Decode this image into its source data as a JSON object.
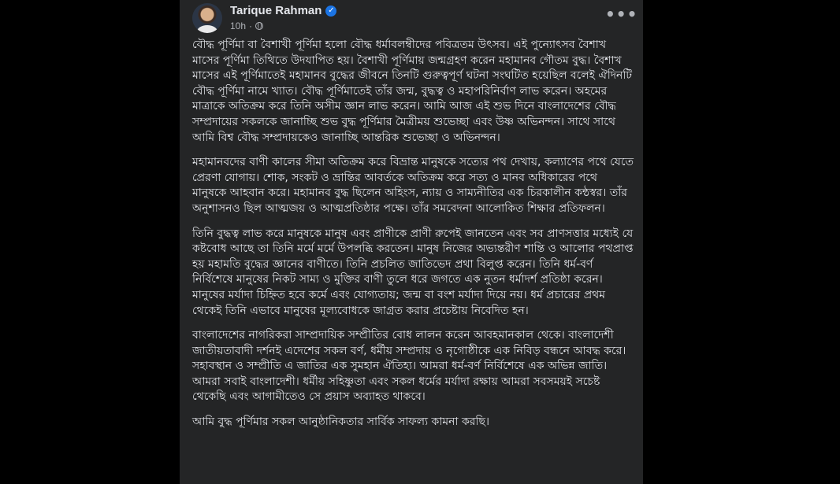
{
  "post": {
    "author": "Tarique Rahman",
    "time": "10h",
    "more_label": "•••",
    "verified_glyph": "✓",
    "paragraphs": [
      "বৌদ্ধ পূর্ণিমা বা বৈশাখী পূর্ণিমা হলো বৌদ্ধ ধর্মাবলম্বীদের পবিত্রতম উৎসব। এই পুন্যোৎসব বৈশাখ মাসের পূর্ণিমা তিথিতে উদযাপিত হয়। বৈশাখী পূর্ণিমায় জন্মগ্রহণ করেন মহামানব গৌতম বুদ্ধ। বৈশাখ মাসের এই পূর্ণিমাতেই মহামানব বুদ্ধের জীবনে তিনটি গুরুত্বপূর্ণ ঘটনা সংঘটিত হয়েছিল বলেই ঐদিনটি বৌদ্ধ পূর্ণিমা নামে খ্যাত। বৌদ্ধ পূর্ণিমাতেই তাঁর জন্ম, বুদ্ধত্ব ও মহাপরিনির্বাণ লাভ করেন। অহমের মাত্রাকে অতিক্রম করে তিনি অসীম জ্ঞান লাভ করেন। আমি আজ এই শুভ দিনে বাংলাদেশের বৌদ্ধ সম্প্রদায়ের সকলকে জানাচ্ছি শুভ বুদ্ধ পূর্ণিমার মৈত্রীময় শুভেচ্ছা এবং উষ্ণ অভিনন্দন। সাথে সাথে আমি বিশ্ব বৌদ্ধ সম্প্রদায়কেও জানাচ্ছি আন্তরিক শুভেচ্ছা ও অভিনন্দন।",
      "মহামানবদের বাণী কালের সীমা অতিক্রম করে বিভ্রান্ত মানুষকে সত্যের পথ দেখায়, কল্যাণের পথে যেতে প্রেরণা যোগায়। শোক, সংকট ও ভ্রান্তির আবর্তকে অতিক্রম করে সত্য ও মানব অধিকারের পথে মানুষকে আহবান করে। মহামানব বুদ্ধ ছিলেন অহিংস, ন্যায় ও সাম্যনীতির এক চিরকালীন কন্ঠস্বর। তাঁর অনুশাসনও ছিল আত্মজয় ও আত্মপ্রতিষ্ঠার পক্ষে। তাঁর সমবেদনা আলোকিত শিক্ষার প্রতিফলন।",
      "তিনি বুদ্ধত্ব লাভ করে মানুষকে মানুষ এবং প্রাণীকে প্রাণী রুপেই জানতেন এবং সব প্রাণসত্তার মধ্যেই যে কষ্টবোধ আছে তা তিনি মর্মে মর্মে উপলব্ধি করতেন। মানুষ নিজের অভ্যন্তরীণ শান্তি ও আলোর পথপ্রাপ্ত হয় মহামতি বুদ্ধের জ্ঞানের বাণীতে। তিনি প্রচলিত জাতিভেদ প্রথা বিলুপ্ত করেন। তিনি ধর্ম-বর্ণ নির্বিশেষে মানুষের নিকট সাম্য ও মুক্তির বাণী তুলে ধরে জগতে এক নুতন ধর্মাদর্শ প্রতিষ্ঠা করেন। মানুষের মর্যাদা চিহ্নিত হবে কর্মে এবং যোগ্যতায়; জন্ম বা বংশ মর্যাদা দিয়ে নয়। ধর্ম প্রচারের প্রথম থেকেই তিনি এভাবে মানুষের মূল্যবোধকে জাগ্রত করার প্রচেষ্টায় নিবেদিত হন।",
      "বাংলাদেশের নাগরিকরা সাম্প্রদায়িক সম্প্রীতির বোধ লালন করেন আবহমানকাল থেকে। বাংলাদেশী জাতীয়তাবাদী দর্শনই এদেশের সকল বর্ণ, ধর্মীয় সম্প্রদায় ও নৃগোষ্ঠীকে এক নিবিড় বন্ধনে আবদ্ধ করে। সহাবস্থান ও সম্প্রীতি এ জাতির এক সুমহান ঐতিহ্য। আমরা ধর্ম-বর্ণ নির্বিশেষে এক অভিন্ন জাতি। আমরা সবাই বাংলাদেশী। ধর্মীয় সহিষ্ণুতা এবং সকল ধর্মের মর্যাদা রক্ষায় আমরা সবসময়ই সচেষ্ট থেকেছি এবং আগামীতেও সে প্রয়াস অব্যাহত থাকবে।",
      "আমি বুদ্ধ পূর্ণিমার সকল আনুষ্ঠানিকতার সার্বিক সাফল্য কামনা করছি।"
    ]
  },
  "colors": {
    "page_background": "#000000",
    "card_background": "#242526",
    "primary_text": "#e4e6eb",
    "secondary_text": "#b0b3b8",
    "verified_badge": "#1b74e4"
  },
  "icons": {
    "avatar": "avatar",
    "verified": "verified-badge-icon",
    "audience": "globe-icon",
    "more": "more-options-icon"
  }
}
